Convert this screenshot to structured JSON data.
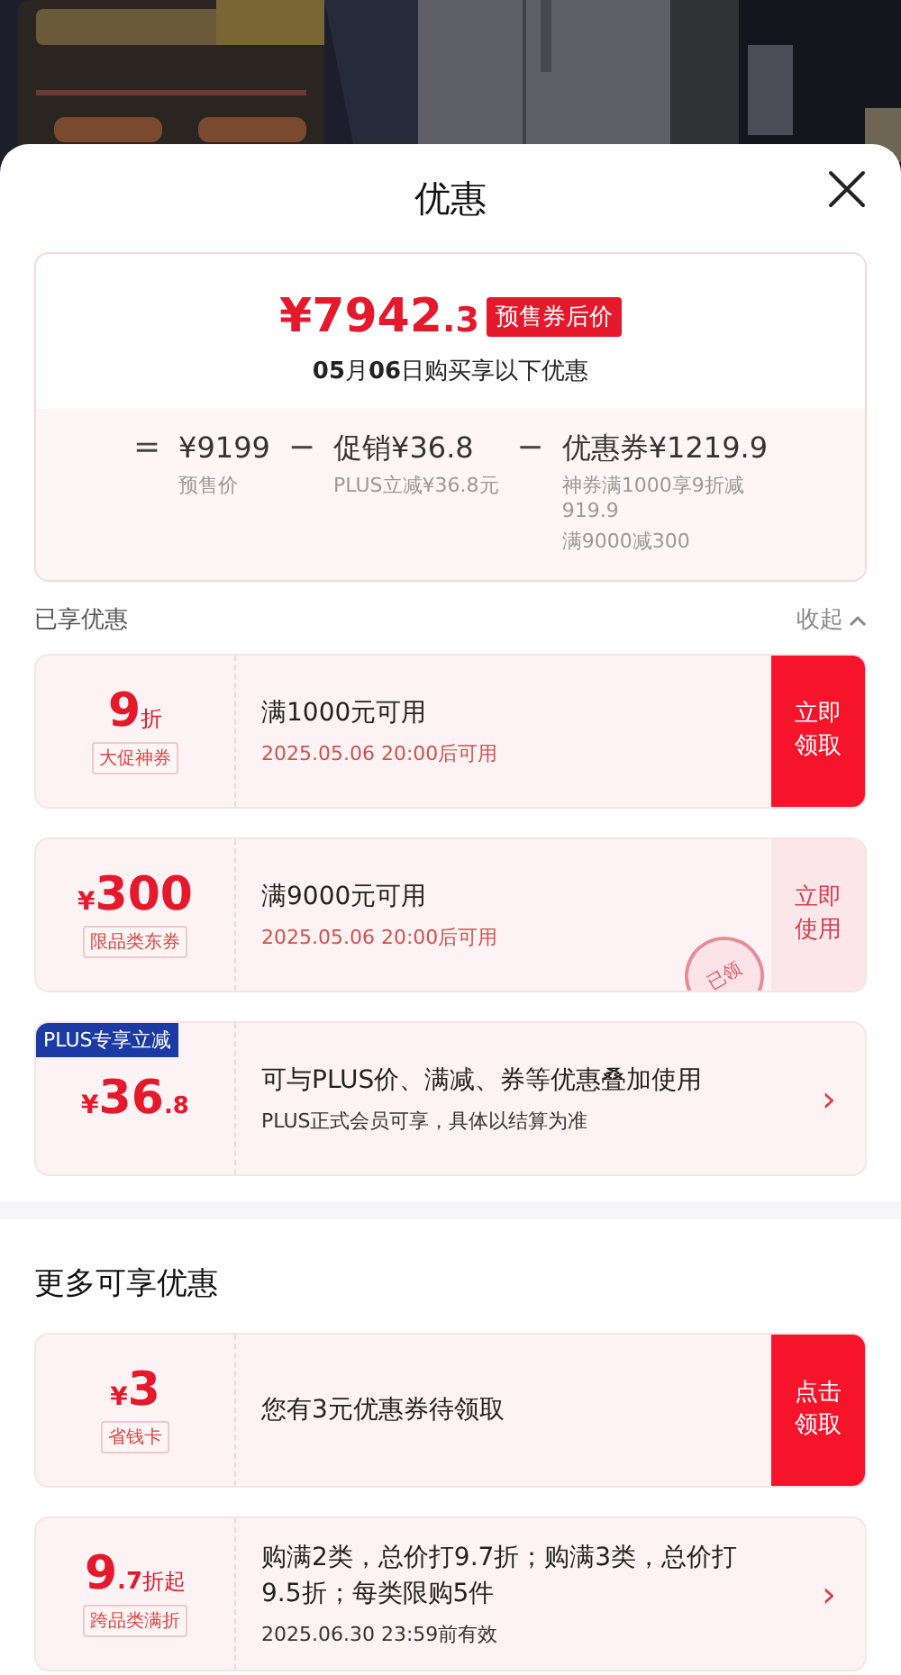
{
  "sheet": {
    "title": "优惠"
  },
  "summary": {
    "price_main": "¥7942",
    "price_decimal": ".3",
    "price_badge": "预售券后价",
    "date_line": "**05**月**06**日购买享以下优惠",
    "breakdown": [
      {
        "operator": "=",
        "amount": "¥9199",
        "notes": [
          "预售价"
        ]
      },
      {
        "operator": "−",
        "label": "促销",
        "amount": "¥36.8",
        "notes": [
          "PLUS立减¥36.8元"
        ]
      },
      {
        "operator": "−",
        "label": "优惠券",
        "amount": "¥1219.9",
        "notes": [
          "神券满1000享9折减919.9",
          "满9000减300"
        ]
      }
    ]
  },
  "enjoyed": {
    "title": "已享优惠",
    "toggle": "收起",
    "expanded": true,
    "coupons": [
      {
        "kind": "voucher",
        "main": "9",
        "unit": "折",
        "tag": "大促神券",
        "title": "满1000元可用",
        "subtitle": "2025.05.06 20:00后可用",
        "action": {
          "kind": "claim",
          "label": "立即领取"
        }
      },
      {
        "kind": "voucher",
        "prefix": "¥",
        "main": "300",
        "tag": "限品类东券",
        "title": "满9000元可用",
        "subtitle": "2025.05.06 20:00后可用",
        "stamp": "已领",
        "action": {
          "kind": "use",
          "label": "立即使用"
        }
      },
      {
        "kind": "offer",
        "prefix": "¥",
        "main": "36",
        "decimal": ".8",
        "corner_badge": "PLUS专享立减",
        "title": "可与PLUS价、满减、券等优惠叠加使用",
        "subtitle": "PLUS正式会员可享，具体以结算为准",
        "action": {
          "kind": "arrow",
          "label": "›"
        }
      }
    ]
  },
  "more": {
    "title": "更多可享优惠",
    "coupons": [
      {
        "prefix": "¥",
        "main": "3",
        "tag": "省钱卡",
        "title": "您有3元优惠券待领取",
        "action": {
          "kind": "claim",
          "label": "点击领取"
        }
      },
      {
        "kind": "offer",
        "main": "9",
        "decimal": ".7",
        "unit": "折起",
        "tag": "跨品类满折",
        "title": "购满2类，总价打9.7折；购满3类，总价打9.5折；每类限购5件",
        "subtitle": "2025.06.30 23:59前有效",
        "action": {
          "kind": "arrow",
          "label": "›"
        }
      }
    ]
  }
}
